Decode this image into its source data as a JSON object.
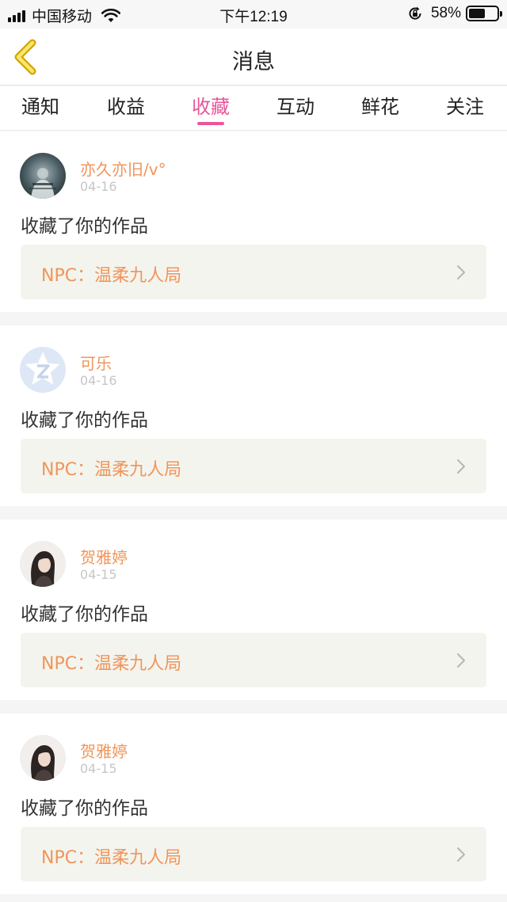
{
  "status_bar": {
    "carrier": "中国移动",
    "time": "下午12:19",
    "battery_percent": "58%",
    "battery_level": 0.58
  },
  "nav": {
    "title": "消息",
    "back_icon": "chevron-left-icon"
  },
  "tabs": [
    {
      "label": "通知",
      "active": false
    },
    {
      "label": "收益",
      "active": false
    },
    {
      "label": "收藏",
      "active": true
    },
    {
      "label": "互动",
      "active": false
    },
    {
      "label": "鲜花",
      "active": false
    },
    {
      "label": "关注",
      "active": false
    }
  ],
  "colors": {
    "accent_pink": "#e8579a",
    "name_orange": "#f0955a",
    "link_bg": "#f4f4ee"
  },
  "items": [
    {
      "user": "亦久亦旧/v°",
      "date": "04-16",
      "action": "收藏了你的作品",
      "work": "NPC：温柔九人局",
      "avatar": "photo-dark"
    },
    {
      "user": "可乐",
      "date": "04-16",
      "action": "收藏了你的作品",
      "work": "NPC：温柔九人局",
      "avatar": "default-q-logo"
    },
    {
      "user": "贺雅婷",
      "date": "04-15",
      "action": "收藏了你的作品",
      "work": "NPC：温柔九人局",
      "avatar": "photo-girl"
    },
    {
      "user": "贺雅婷",
      "date": "04-15",
      "action": "收藏了你的作品",
      "work": "NPC：温柔九人局",
      "avatar": "photo-girl"
    }
  ]
}
